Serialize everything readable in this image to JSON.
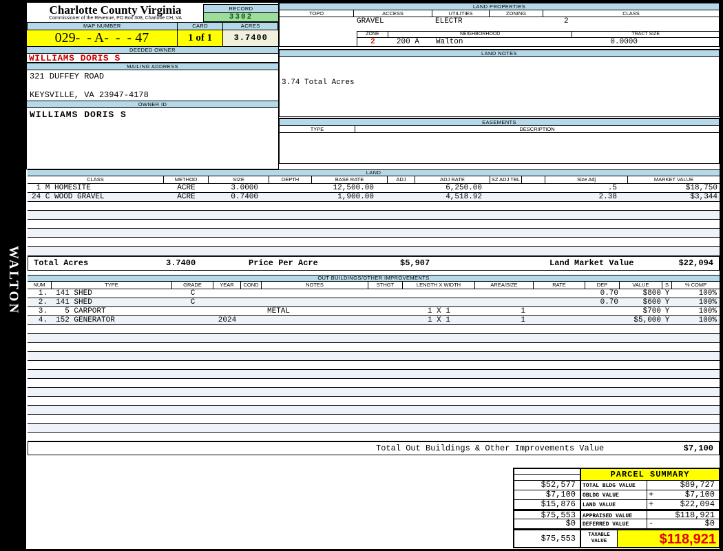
{
  "title": {
    "county": "Charlotte County Virginia",
    "commissioner": "Commissioner of the Revenue, PO Box 308, Charlotte CH, VA"
  },
  "sidebar": {
    "district_label": "WALTON"
  },
  "id_card": {
    "record_label": "RECORD",
    "record_value": "3302",
    "map_number_label": "MAP NUMBER",
    "map_number_value": "029-  - A-  -  - 47",
    "card_label": "CARD",
    "card_value": "1 of 1",
    "acres_label": "ACRES",
    "acres_value": "3.7400",
    "deeded_owner_label": "DEEDED OWNER",
    "deeded_owner_value": "WILLIAMS DORIS S",
    "mailing_address_label": "MAILING ADDRESS",
    "address_line1": "321 DUFFEY ROAD",
    "address_line2": "KEYSVILLE, VA 23947-4178",
    "owner_id_label": "OWNER ID",
    "owner_id_value": "WILLIAMS DORIS S"
  },
  "land_properties": {
    "title": "LAND PROPERTIES",
    "columns": [
      "TOPO",
      "ACCESS",
      "UTILITIES",
      "ZONING",
      "CLASS"
    ],
    "values": {
      "topo": "",
      "access": "GRAVEL",
      "utilities": "ELECTR",
      "zoning": "",
      "class": "2"
    },
    "zone_label": "ZONE",
    "zone_value": "2",
    "neighborhood_label": "NEIGHBORHOOD",
    "neighborhood_code": "200 A",
    "neighborhood_name": "Walton",
    "tract_size_label": "TRACT SIZE",
    "tract_size_value": "0.0000"
  },
  "land_notes": {
    "title": "LAND NOTES",
    "note": "3.74 Total Acres"
  },
  "easements": {
    "title": "EASEMENTS",
    "type_label": "TYPE",
    "description_label": "DESCRIPTION"
  },
  "land": {
    "title": "LAND",
    "columns": [
      "CLASS",
      "METHOD",
      "SIZE",
      "DEPTH",
      "BASE RATE",
      "ADJ",
      "ADJ RATE",
      "SZ ADJ TBL",
      "",
      "Size Adj",
      "MARKET VALUE"
    ],
    "rows": [
      {
        "class": " 1 M HOMESITE",
        "method": "ACRE",
        "size": "3.0000",
        "depth": "",
        "base_rate": "12,500.00",
        "adj": "",
        "adj_rate": "6,250.00",
        "sz_adj_tbl": "",
        "sz": "",
        "size_adj": ".5",
        "market_value": "$18,750"
      },
      {
        "class": "24 C WOOD GRAVEL",
        "method": "ACRE",
        "size": "0.7400",
        "depth": "",
        "base_rate": "1,900.00",
        "adj": "",
        "adj_rate": "4,518.92",
        "sz_adj_tbl": "",
        "sz": "",
        "size_adj": "2.38",
        "market_value": "$3,344"
      }
    ],
    "totals": {
      "total_acres_label": "Total Acres",
      "total_acres_value": "3.7400",
      "price_per_acre_label": "Price Per Acre",
      "price_per_acre_value": "$5,907",
      "land_market_value_label": "Land Market Value",
      "land_market_value": "$22,094"
    }
  },
  "out_buildings": {
    "title": "OUT BUILDINGS/OTHER IMPROVEMENTS",
    "columns": [
      "NUM",
      "TYPE",
      "GRADE",
      "YEAR",
      "COND",
      "NOTES",
      "STHGT",
      "LENGTH X WIDTH",
      "AREA/SIZE",
      "RATE",
      "DEP",
      "VALUE",
      "S",
      "% COMP"
    ],
    "rows": [
      {
        "num": "1.",
        "type": "141 SHED",
        "grade": "C",
        "year": "",
        "cond": "",
        "notes": "",
        "sthgt": "",
        "length_width": "",
        "area_size": "",
        "rate": "",
        "dep": "0.70",
        "value": "$800",
        "s": "Y",
        "pct_comp": "100%"
      },
      {
        "num": "2.",
        "type": "141 SHED",
        "grade": "C",
        "year": "",
        "cond": "",
        "notes": "",
        "sthgt": "",
        "length_width": "",
        "area_size": "",
        "rate": "",
        "dep": "0.70",
        "value": "$600",
        "s": "Y",
        "pct_comp": "100%"
      },
      {
        "num": "3.",
        "type": "  5 CARPORT",
        "grade": "",
        "year": "",
        "cond": "",
        "notes": "METAL",
        "sthgt": "",
        "length_width": "1 X 1",
        "area_size": "1",
        "rate": "",
        "dep": "",
        "value": "$700",
        "s": "Y",
        "pct_comp": "100%"
      },
      {
        "num": "4.",
        "type": "152 GENERATOR",
        "grade": "",
        "year": "2024",
        "cond": "",
        "notes": "",
        "sthgt": "",
        "length_width": "1 X 1",
        "area_size": "1",
        "rate": "",
        "dep": "",
        "value": "$5,000",
        "s": "Y",
        "pct_comp": "100%"
      }
    ],
    "total_label": "Total Out Buildings & Other Improvements Value",
    "total_value": "$7,100"
  },
  "parcel_summary": {
    "title": "PARCEL SUMMARY",
    "rows": [
      {
        "prior": "$52,577",
        "label": "TOTAL BLDG VALUE",
        "sign": "",
        "value": "$89,727"
      },
      {
        "prior": "$7,100",
        "label": "OBLDG VALUE",
        "sign": "+",
        "value": "$7,100"
      },
      {
        "prior": "$15,876",
        "label": "LAND VALUE",
        "sign": "+",
        "value": "$22,094"
      },
      {
        "prior": "$75,553",
        "label": "APPRAISED VALUE",
        "sign": "",
        "value": "$118,921"
      },
      {
        "prior": "$0",
        "label": "DEFERRED VALUE",
        "sign": "-",
        "value": "$0"
      }
    ],
    "taxable": {
      "prior": "$75,553",
      "label": "TAXABLE VALUE",
      "value": "$118,921"
    }
  },
  "colors": {
    "header_blue": "#b5d9e8",
    "record_green": "#9ade9a",
    "highlight_yellow": "#ffff00",
    "acres_cream": "#f0f0dc",
    "row_stripe": "#eef2f9",
    "owner_red": "#cc0000",
    "summary_red": "#e60000"
  }
}
